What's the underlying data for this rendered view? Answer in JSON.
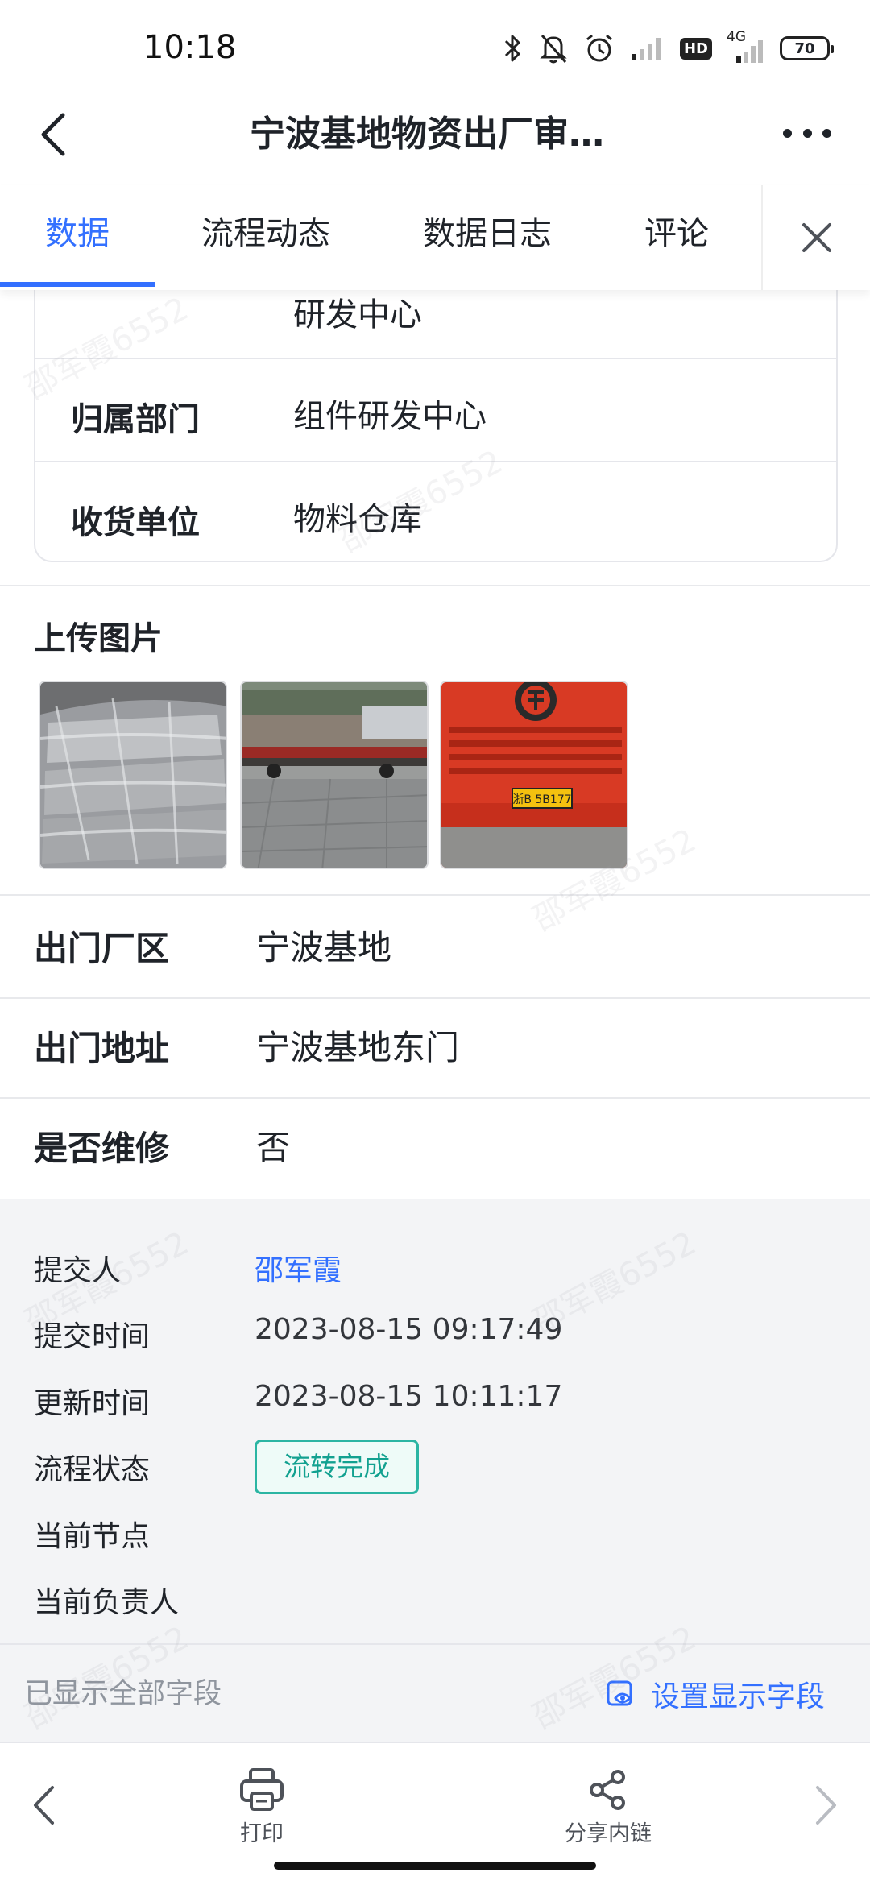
{
  "status_bar": {
    "time": "10:18",
    "network": "4G",
    "hd": "HD",
    "battery": "70"
  },
  "header": {
    "title": "宁波基地物资出厂审…"
  },
  "tabs": [
    {
      "label": "数据",
      "active": true
    },
    {
      "label": "流程动态",
      "active": false
    },
    {
      "label": "数据日志",
      "active": false
    },
    {
      "label": "评论",
      "active": false
    }
  ],
  "card": {
    "partial_value": "研发中心",
    "rows": [
      {
        "label": "归属部门",
        "value": "组件研发中心"
      },
      {
        "label": "收货单位",
        "value": "物料仓库"
      }
    ]
  },
  "upload": {
    "title": "上传图片",
    "images": [
      {
        "icon": "wrapped-goods-photo"
      },
      {
        "icon": "flatbed-truck-photo"
      },
      {
        "icon": "red-truck-front-photo",
        "plate": "浙B 5B177"
      }
    ]
  },
  "fields": [
    {
      "label": "出门厂区",
      "value": "宁波基地"
    },
    {
      "label": "出门地址",
      "value": "宁波基地东门"
    },
    {
      "label": "是否维修",
      "value": "否"
    }
  ],
  "meta": {
    "submitter_label": "提交人",
    "submitter": "邵军霞",
    "submit_time_label": "提交时间",
    "submit_time": "2023-08-15 09:17:49",
    "update_time_label": "更新时间",
    "update_time": "2023-08-15 10:11:17",
    "status_label": "流程状态",
    "status": "流转完成",
    "node_label": "当前节点",
    "owner_label": "当前负责人"
  },
  "footer": {
    "shown_all": "已显示全部字段",
    "settings": "设置显示字段"
  },
  "toolbar": {
    "print": "打印",
    "share": "分享内链"
  },
  "watermark": "邵军霞6552",
  "colors": {
    "accent": "#3370ff",
    "status_green": "#12a190",
    "meta_bg": "#f3f4f6"
  }
}
